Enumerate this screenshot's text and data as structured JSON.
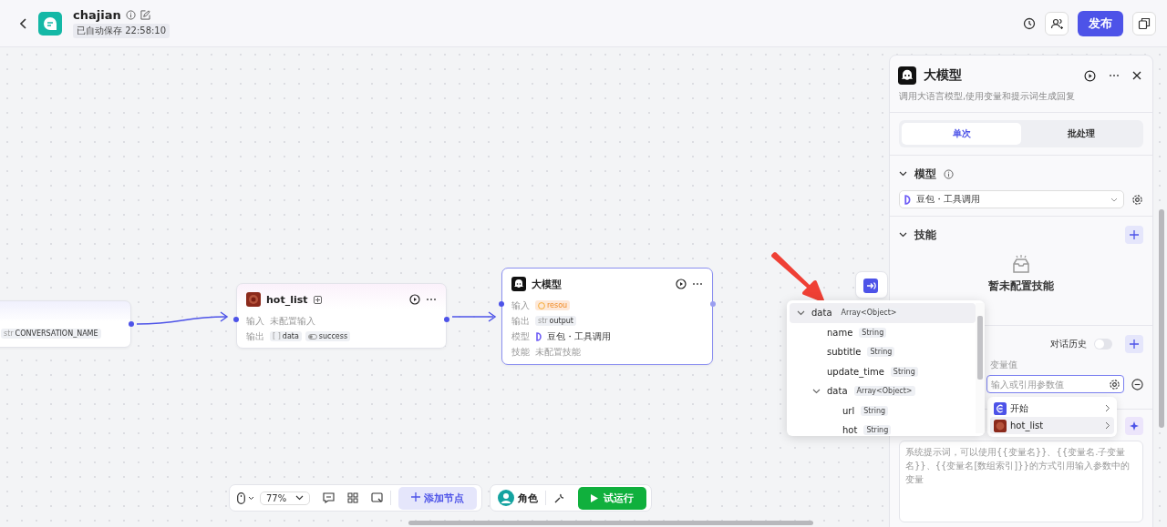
{
  "header": {
    "title": "chajian",
    "autosave": "已自动保存 22:58:10",
    "publish": "发布"
  },
  "nodes": [
    {
      "kind": "partial",
      "tags": [
        {
          "type": "str",
          "name": "CONVERSATION_NAME"
        }
      ]
    },
    {
      "kind": "plugin",
      "title": "hot_list",
      "rows": [
        {
          "label": "输入",
          "value": "未配置输入"
        },
        {
          "label": "输出",
          "tags": [
            {
              "kind": "text",
              "type": "[ ]",
              "name": "data"
            },
            {
              "kind": "boolean",
              "name": "success"
            }
          ]
        }
      ]
    },
    {
      "kind": "llm",
      "title": "大模型",
      "rows": [
        {
          "label": "输入",
          "warn": "resou"
        },
        {
          "label": "输出",
          "tags": [
            {
              "kind": "text",
              "type": "str",
              "name": "output"
            }
          ]
        },
        {
          "label": "模型",
          "model": "豆包・工具调用"
        },
        {
          "label": "技能",
          "value": "未配置技能"
        }
      ]
    },
    {
      "kind": "end"
    }
  ],
  "panel": {
    "title": "大模型",
    "description": "调用大语言模型,使用变量和提示词生成回复",
    "tabs": [
      {
        "label": "单次",
        "selected": true
      },
      {
        "label": "批处理",
        "selected": false
      }
    ],
    "model_section": {
      "title": "模型",
      "model": "豆包・工具调用",
      "expanded": true
    },
    "skill_section": {
      "title": "技能",
      "empty": "暂未配置技能",
      "expanded": true
    },
    "history": {
      "label": "对话历史",
      "on": false
    },
    "variable": {
      "label": "变量值",
      "placeholder": "输入或引用参数值"
    },
    "prompt": {
      "placeholder": "系统提示词，可以使用{{变量名}}、{{变量名.子变量名}}、{{变量名[数组索引]}}的方式引用输入参数中的变量"
    }
  },
  "source_menu": [
    {
      "label": "开始",
      "kind": "start"
    },
    {
      "label": "hot_list",
      "kind": "plugin"
    }
  ],
  "tree": [
    {
      "name": "data",
      "type": "Array<Object>",
      "selected": true,
      "expanded": true,
      "children": [
        {
          "name": "name",
          "type": "String",
          "selected": false
        },
        {
          "name": "subtitle",
          "type": "String",
          "selected": false
        },
        {
          "name": "update_time",
          "type": "String",
          "selected": false
        },
        {
          "name": "data",
          "type": "Array<Object>",
          "selected": false,
          "expanded": true,
          "children": [
            {
              "name": "url",
              "type": "String",
              "selected": false
            },
            {
              "name": "hot",
              "type": "String",
              "selected": false
            }
          ]
        }
      ]
    }
  ],
  "toolbar": {
    "zoom": "77%",
    "add_node": "添加节点",
    "role": "角色",
    "run": "试运行"
  }
}
